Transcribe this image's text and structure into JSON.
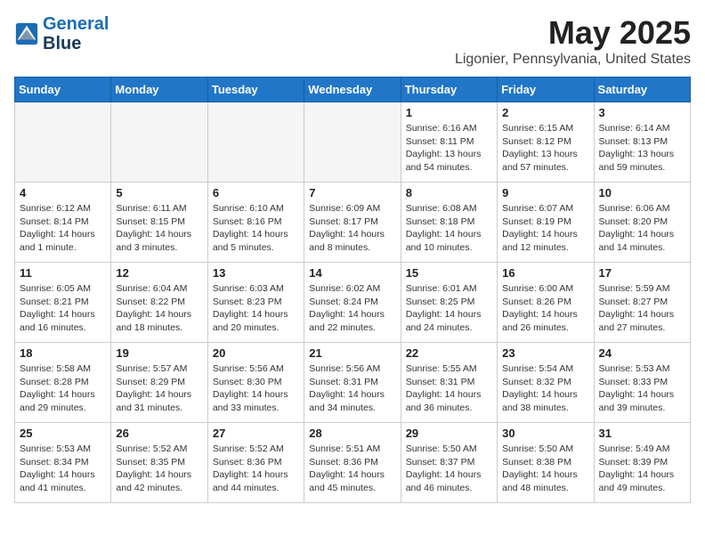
{
  "header": {
    "logo_line1": "General",
    "logo_line2": "Blue",
    "month": "May 2025",
    "location": "Ligonier, Pennsylvania, United States"
  },
  "weekdays": [
    "Sunday",
    "Monday",
    "Tuesday",
    "Wednesday",
    "Thursday",
    "Friday",
    "Saturday"
  ],
  "weeks": [
    [
      {
        "day": "",
        "info": ""
      },
      {
        "day": "",
        "info": ""
      },
      {
        "day": "",
        "info": ""
      },
      {
        "day": "",
        "info": ""
      },
      {
        "day": "1",
        "info": "Sunrise: 6:16 AM\nSunset: 8:11 PM\nDaylight: 13 hours and 54 minutes."
      },
      {
        "day": "2",
        "info": "Sunrise: 6:15 AM\nSunset: 8:12 PM\nDaylight: 13 hours and 57 minutes."
      },
      {
        "day": "3",
        "info": "Sunrise: 6:14 AM\nSunset: 8:13 PM\nDaylight: 13 hours and 59 minutes."
      }
    ],
    [
      {
        "day": "4",
        "info": "Sunrise: 6:12 AM\nSunset: 8:14 PM\nDaylight: 14 hours and 1 minute."
      },
      {
        "day": "5",
        "info": "Sunrise: 6:11 AM\nSunset: 8:15 PM\nDaylight: 14 hours and 3 minutes."
      },
      {
        "day": "6",
        "info": "Sunrise: 6:10 AM\nSunset: 8:16 PM\nDaylight: 14 hours and 5 minutes."
      },
      {
        "day": "7",
        "info": "Sunrise: 6:09 AM\nSunset: 8:17 PM\nDaylight: 14 hours and 8 minutes."
      },
      {
        "day": "8",
        "info": "Sunrise: 6:08 AM\nSunset: 8:18 PM\nDaylight: 14 hours and 10 minutes."
      },
      {
        "day": "9",
        "info": "Sunrise: 6:07 AM\nSunset: 8:19 PM\nDaylight: 14 hours and 12 minutes."
      },
      {
        "day": "10",
        "info": "Sunrise: 6:06 AM\nSunset: 8:20 PM\nDaylight: 14 hours and 14 minutes."
      }
    ],
    [
      {
        "day": "11",
        "info": "Sunrise: 6:05 AM\nSunset: 8:21 PM\nDaylight: 14 hours and 16 minutes."
      },
      {
        "day": "12",
        "info": "Sunrise: 6:04 AM\nSunset: 8:22 PM\nDaylight: 14 hours and 18 minutes."
      },
      {
        "day": "13",
        "info": "Sunrise: 6:03 AM\nSunset: 8:23 PM\nDaylight: 14 hours and 20 minutes."
      },
      {
        "day": "14",
        "info": "Sunrise: 6:02 AM\nSunset: 8:24 PM\nDaylight: 14 hours and 22 minutes."
      },
      {
        "day": "15",
        "info": "Sunrise: 6:01 AM\nSunset: 8:25 PM\nDaylight: 14 hours and 24 minutes."
      },
      {
        "day": "16",
        "info": "Sunrise: 6:00 AM\nSunset: 8:26 PM\nDaylight: 14 hours and 26 minutes."
      },
      {
        "day": "17",
        "info": "Sunrise: 5:59 AM\nSunset: 8:27 PM\nDaylight: 14 hours and 27 minutes."
      }
    ],
    [
      {
        "day": "18",
        "info": "Sunrise: 5:58 AM\nSunset: 8:28 PM\nDaylight: 14 hours and 29 minutes."
      },
      {
        "day": "19",
        "info": "Sunrise: 5:57 AM\nSunset: 8:29 PM\nDaylight: 14 hours and 31 minutes."
      },
      {
        "day": "20",
        "info": "Sunrise: 5:56 AM\nSunset: 8:30 PM\nDaylight: 14 hours and 33 minutes."
      },
      {
        "day": "21",
        "info": "Sunrise: 5:56 AM\nSunset: 8:31 PM\nDaylight: 14 hours and 34 minutes."
      },
      {
        "day": "22",
        "info": "Sunrise: 5:55 AM\nSunset: 8:31 PM\nDaylight: 14 hours and 36 minutes."
      },
      {
        "day": "23",
        "info": "Sunrise: 5:54 AM\nSunset: 8:32 PM\nDaylight: 14 hours and 38 minutes."
      },
      {
        "day": "24",
        "info": "Sunrise: 5:53 AM\nSunset: 8:33 PM\nDaylight: 14 hours and 39 minutes."
      }
    ],
    [
      {
        "day": "25",
        "info": "Sunrise: 5:53 AM\nSunset: 8:34 PM\nDaylight: 14 hours and 41 minutes."
      },
      {
        "day": "26",
        "info": "Sunrise: 5:52 AM\nSunset: 8:35 PM\nDaylight: 14 hours and 42 minutes."
      },
      {
        "day": "27",
        "info": "Sunrise: 5:52 AM\nSunset: 8:36 PM\nDaylight: 14 hours and 44 minutes."
      },
      {
        "day": "28",
        "info": "Sunrise: 5:51 AM\nSunset: 8:36 PM\nDaylight: 14 hours and 45 minutes."
      },
      {
        "day": "29",
        "info": "Sunrise: 5:50 AM\nSunset: 8:37 PM\nDaylight: 14 hours and 46 minutes."
      },
      {
        "day": "30",
        "info": "Sunrise: 5:50 AM\nSunset: 8:38 PM\nDaylight: 14 hours and 48 minutes."
      },
      {
        "day": "31",
        "info": "Sunrise: 5:49 AM\nSunset: 8:39 PM\nDaylight: 14 hours and 49 minutes."
      }
    ]
  ]
}
